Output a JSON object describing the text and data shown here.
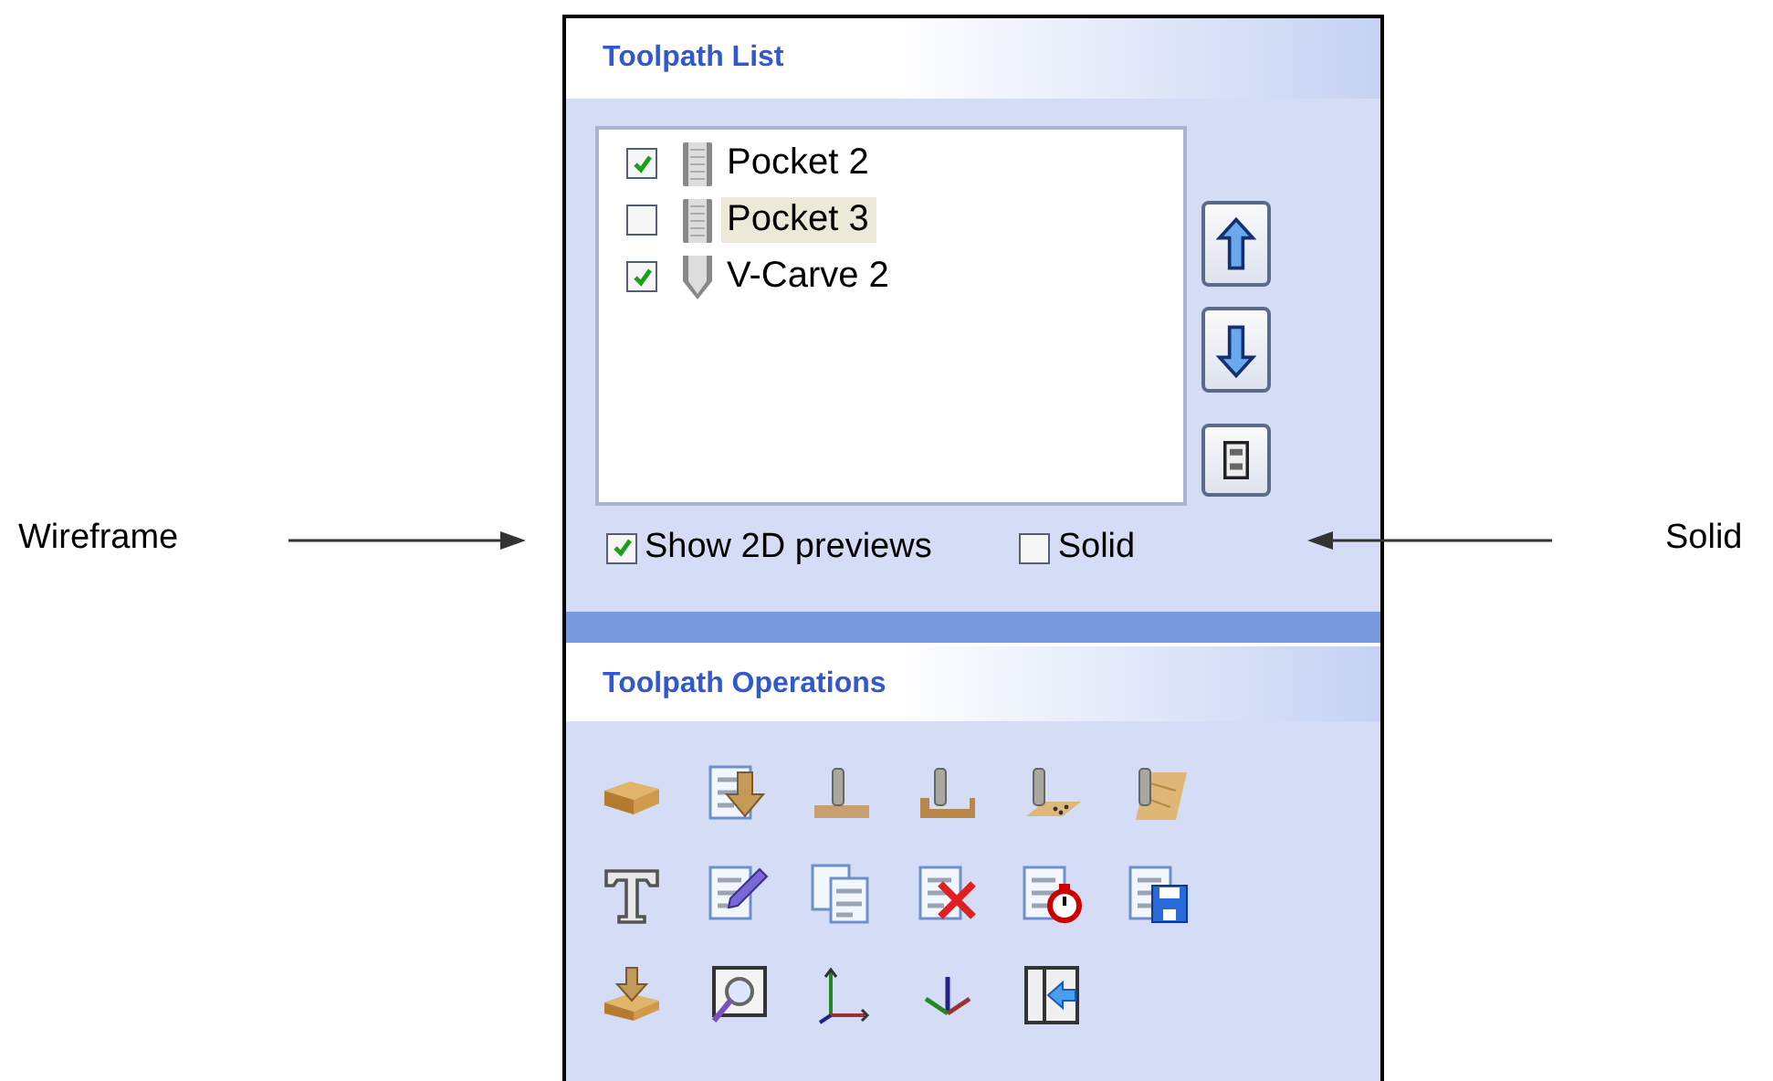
{
  "annotations": [
    {
      "label": "Wireframe"
    },
    {
      "label": "Solid"
    }
  ],
  "toolpath_list": {
    "title": "Toolpath List",
    "items": [
      {
        "label": "Pocket 2",
        "kind": "pocket",
        "checked": true,
        "selected": false
      },
      {
        "label": "Pocket 3",
        "kind": "pocket",
        "checked": false,
        "selected": true
      },
      {
        "label": "V-Carve 2",
        "kind": "vcarve",
        "checked": true,
        "selected": false
      }
    ],
    "options": [
      {
        "label": "Show 2D previews",
        "checked": true
      },
      {
        "label": "Solid",
        "checked": false
      }
    ]
  },
  "toolpath_operations": {
    "title": "Toolpath Operations"
  }
}
